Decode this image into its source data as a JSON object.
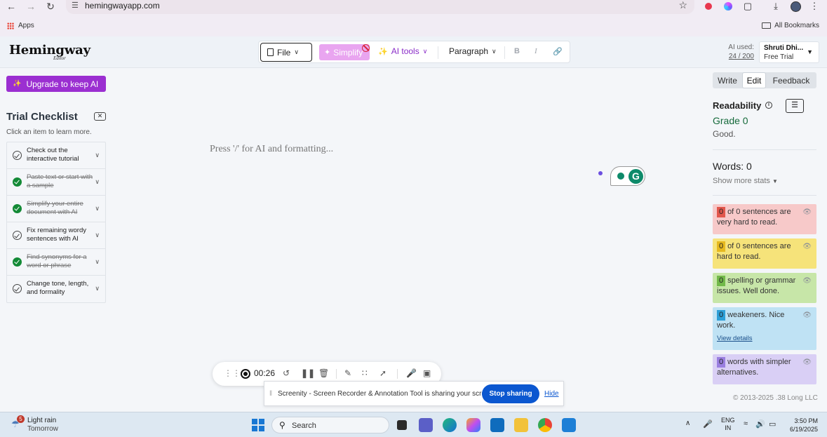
{
  "browser": {
    "url": "hemingwayapp.com",
    "bookmarks": {
      "apps": "Apps",
      "all": "All Bookmarks"
    }
  },
  "header": {
    "logo": "Hemingway",
    "logo_sub": "Editor",
    "toolbar": {
      "file": "File",
      "simplify": "Simplify",
      "ai_tools": "AI tools",
      "paragraph": "Paragraph",
      "bold": "B",
      "italic": "I"
    },
    "ai_used_label": "AI used:",
    "ai_used_count": "24 / 200",
    "user_name": "Shruti Dhi...",
    "user_plan": "Free Trial"
  },
  "sidebar": {
    "upgrade": "Upgrade to keep AI",
    "checklist_title": "Trial Checklist",
    "checklist_hint": "Click an item to learn more.",
    "items": [
      {
        "label": "Check out the interactive tutorial",
        "done": false
      },
      {
        "label": "Paste text or start with a sample",
        "done": true
      },
      {
        "label": "Simplify your entire document with AI",
        "done": true
      },
      {
        "label": "Fix remaining wordy sentences with AI",
        "done": false
      },
      {
        "label": "Find synonyms for a word or phrase",
        "done": true
      },
      {
        "label": "Change tone, length, and formality",
        "done": false
      }
    ]
  },
  "editor": {
    "placeholder": "Press '/' for AI and formatting..."
  },
  "panel": {
    "tabs": [
      "Write",
      "Edit",
      "Feedback"
    ],
    "active_tab": "Edit",
    "readability": "Readability",
    "grade": "Grade 0",
    "grade_comment": "Good.",
    "words": "Words: 0",
    "more_stats": "Show more stats",
    "cards": {
      "very_hard": {
        "count": "0",
        "text": "of 0 sentences are very hard to read."
      },
      "hard": {
        "count": "0",
        "text": "of 0 sentences are hard to read."
      },
      "spelling": {
        "count": "0",
        "text": "spelling or grammar issues. Well done."
      },
      "weakeners": {
        "count": "0",
        "text": "weakeners. Nice work.",
        "link": "View details"
      },
      "simpler": {
        "count": "0",
        "text": "words with simpler alternatives."
      }
    },
    "copyright": "© 2013-2025 .38 Long LLC"
  },
  "recorder": {
    "time": "00:26",
    "share_text": "Screenity - Screen Recorder & Annotation Tool is sharing your screen.",
    "stop": "Stop sharing",
    "hide": "Hide"
  },
  "taskbar": {
    "weather_badge": "5",
    "weather_line1": "Light rain",
    "weather_line2": "Tomorrow",
    "search": "Search",
    "lang1": "ENG",
    "lang2": "IN",
    "time": "3:50 PM",
    "date": "6/19/2025"
  },
  "colors": {
    "accent_purple": "#9b2fd1",
    "grade_green": "#166a3b",
    "stop_blue": "#0b57d0"
  }
}
